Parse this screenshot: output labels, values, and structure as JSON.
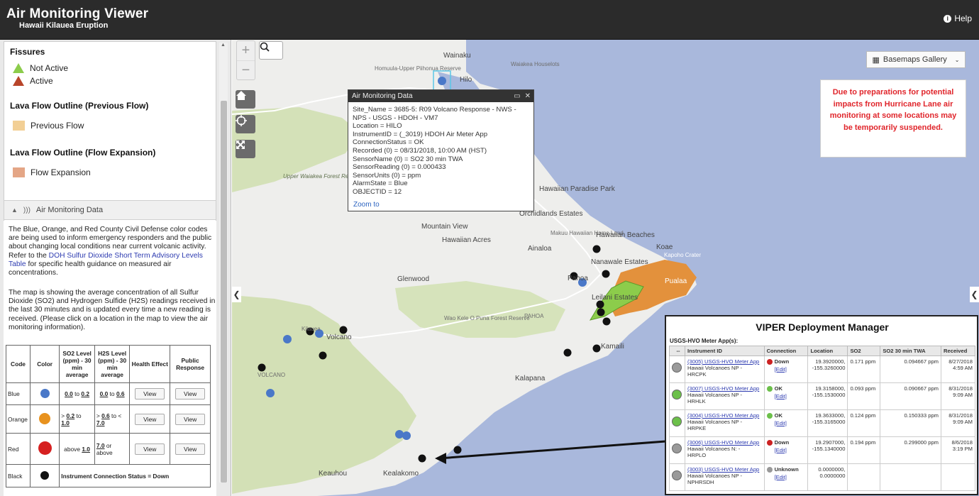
{
  "header": {
    "title": "Air Monitoring Viewer",
    "subtitle": "Hawaii Kilauea Eruption",
    "help_label": "Help"
  },
  "legend": {
    "fissures_title": "Fissures",
    "not_active": "Not Active",
    "active": "Active",
    "prev_title": "Lava Flow Outline (Previous Flow)",
    "prev_label": "Previous Flow",
    "exp_title": "Lava Flow Outline (Flow Expansion)",
    "exp_label": "Flow Expansion",
    "colors": {
      "not_active": "#8ccc4b",
      "active": "#b8452a",
      "previous": "#f2cf95",
      "expansion": "#e4a686"
    }
  },
  "panel": {
    "title": "Air Monitoring Data",
    "p1_a": "The Blue, Orange, and Red County Civil Defense color codes are being used to inform emergency responders and the public about changing local conditions near current volcanic activity. Refer to the ",
    "p1_link": "DOH Sulfur Dioxide Short Term Advisory Levels Table",
    "p1_b": " for specific health guidance on measured air concentrations.",
    "p2": "The map is showing the average concentration of all Sulfur Dioxide (SO2) and Hydrogen Sulfide (H2S) readings received in the last 30 minutes and is updated every time a new reading is received. (Please click on a location in the map to view the air monitoring information).",
    "table": {
      "headers": [
        "Code",
        "Color",
        "SO2 Level (ppm) - 30 min average",
        "H2S Level (ppm) - 30 min average",
        "Health Effect",
        "Public Response"
      ],
      "view": "View",
      "blue": {
        "code": "Blue",
        "so2_a": "0.0",
        "so2_b": "0.2",
        "h2s_a": "0.0",
        "h2s_b": "0.6",
        "to": "to"
      },
      "orange": {
        "code": "Orange",
        "so2_pre": "> ",
        "so2_a": "0.2",
        "so2_b": "1.0",
        "h2s_pre": "> ",
        "h2s_a": "0.6",
        "h2s_b": "7.0",
        "to": "to",
        "to_lt": "to <"
      },
      "red": {
        "code": "Red",
        "so2_pre": "above ",
        "so2_a": "1.0",
        "h2s_a": "7.0",
        "h2s_post": " or above"
      },
      "black": {
        "code": "Black",
        "status": "Instrument Connection Status = Down"
      },
      "dot_colors": {
        "blue": "#4a78c8",
        "orange": "#e8921e",
        "red": "#d62020",
        "black": "#111111"
      }
    }
  },
  "map": {
    "basemaps_label": "Basemaps Gallery",
    "notice": "Due to preparations for potential impacts from Hurricane Lane air monitoring at some locations may be temporarily suspended.",
    "labels": {
      "wainaku": "Wainaku",
      "hilo": "Hilo",
      "homuula": "Homuula-Upper Piihonua Reserve",
      "waiakea": "Waiakea Houselots",
      "upper_waiakea": "Upper Waiakea Forest Reserve",
      "hawaiian_paradise": "Hawaiian Paradise Park",
      "orchidlands": "Orchidlands Estates",
      "mountain_view": "Mountain View",
      "hawaiian_acres": "Hawaiian Acres",
      "ainaloa": "Ainaloa",
      "makuu": "Makuu Hawaiian Home Land",
      "hawaiian_beaches": "Hawaiian Beaches",
      "nanawale": "Nanawale Estates",
      "koae": "Koae",
      "kapoho": "Kapoho Crater",
      "pahoa_town": "Pahoa",
      "leilani": "Leilani Estates",
      "pualaa": "Pualaa",
      "glenwood": "Glenwood",
      "pahoa": "PAHOA",
      "waokele": "Wao Kele O Puna Forest Reserve",
      "volcano": "Volcano",
      "kilauea": "Kilauea",
      "volcano_area": "VOLCANO",
      "kamaili": "Kamaili",
      "kalapana": "Kalapana",
      "keauhou": "Keauhou",
      "kealakomo": "Kealakomo"
    }
  },
  "popup": {
    "title": "Air Monitoring Data",
    "lines": [
      "Site_Name = 3685-5: R09 Volcano Response - NWS -",
      "NPS - USGS - HDOH - VM7",
      "Location = HILO",
      "InstrumentID = (_3019) HDOH Air Meter App",
      "ConnectionStatus = OK",
      "Recorded (0) = 08/31/2018, 10:00 AM (HST)",
      "SensorName (0) = SO2 30 min TWA",
      "SensorReading (0) = 0.000433",
      "SensorUnits (0) = ppm",
      "AlarmState = Blue",
      "OBJECTID = 12"
    ],
    "zoom_to": "Zoom to"
  },
  "viper": {
    "title": "VIPER Deployment Manager",
    "subtitle": "USGS-HVO Meter App(s):",
    "headers": [
      "--",
      "Instrument ID",
      "Connection",
      "Location",
      "SO2",
      "SO2 30 min TWA",
      "Received"
    ],
    "edit": "[Edit]",
    "rows": [
      {
        "status_color": "#9a9a9a",
        "id": "(3005) USGS-HVO Meter App",
        "site": "Hawaii Volcanoes NP -",
        "code": "HRCPK",
        "conn": "Down",
        "conn_color": "#cc2222",
        "lat": "19.3920000,",
        "lon": "-155.3260000",
        "so2": "0.171 ppm",
        "twa": "0.094667 ppm",
        "date": "8/27/2018",
        "time": "4:59 AM"
      },
      {
        "status_color": "#6cc04a",
        "id": "(3007) USGS-HVO Meter App",
        "site": "Hawaii Volcanoes NP -",
        "code": "HRHLK",
        "conn": "OK",
        "conn_color": "#6cc04a",
        "lat": "19.3158000,",
        "lon": "-155.1530000",
        "so2": "0.093 ppm",
        "twa": "0.090667 ppm",
        "date": "8/31/2018",
        "time": "9:09 AM"
      },
      {
        "status_color": "#6cc04a",
        "id": "(3004) USGS-HVO Meter App",
        "site": "Hawaii Volcanoes NP -",
        "code": "HRPKE",
        "conn": "OK",
        "conn_color": "#6cc04a",
        "lat": "19.3633000,",
        "lon": "-155.3165000",
        "so2": "0.124 ppm",
        "twa": "0.150333 ppm",
        "date": "8/31/2018",
        "time": "9:09 AM"
      },
      {
        "status_color": "#9a9a9a",
        "id": "(3006) USGS-HVO Meter App",
        "site": "Hawaii Volcanoes N: -",
        "code": "HRPLO",
        "conn": "Down",
        "conn_color": "#cc2222",
        "lat": "19.2907000,",
        "lon": "-155.1340000",
        "so2": "0.194 ppm",
        "twa": "0.299000 ppm",
        "date": "8/6/2018",
        "time": "3:19 PM"
      },
      {
        "status_color": "#9a9a9a",
        "id": "(3003) USGS-HVO Meter App",
        "site": "Hawaii Volcanoes NP -",
        "code": "NPHRSDH",
        "conn": "Unknown",
        "conn_color": "#999999",
        "lat": "0.0000000,",
        "lon": "0.0000000",
        "so2": "",
        "twa": "",
        "date": "",
        "time": ""
      }
    ]
  }
}
